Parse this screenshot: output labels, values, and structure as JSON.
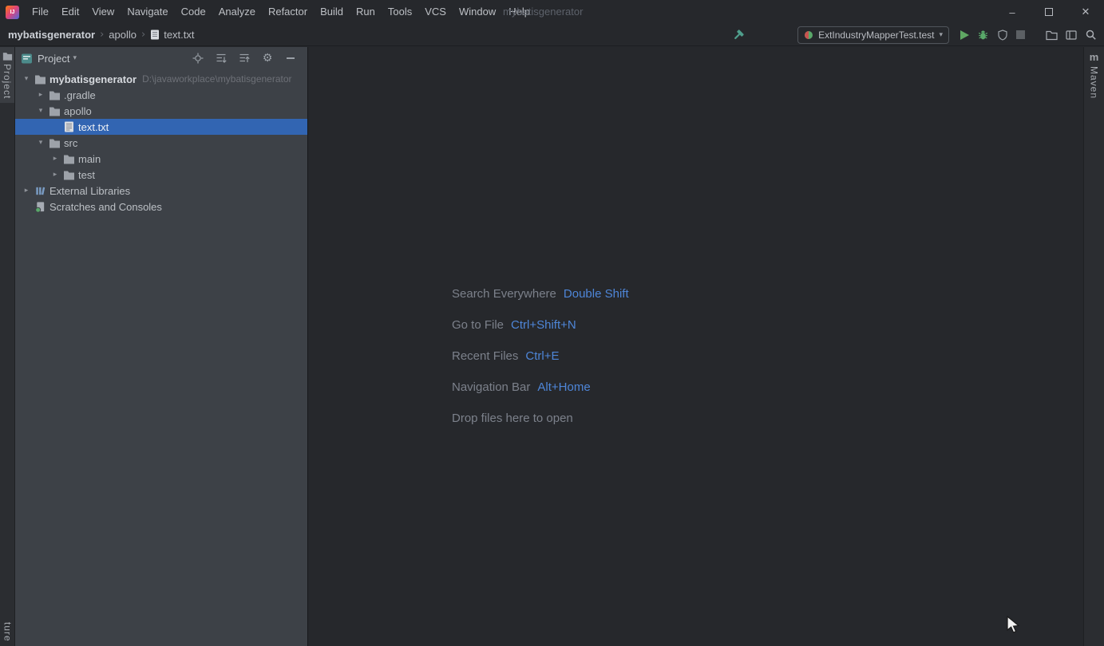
{
  "icons": {
    "logo_text": "IJ",
    "minimize": "–",
    "close": "✕",
    "dropdown": "▾",
    "chevron_down": "▾",
    "chevron_right": "▸",
    "breadcrumb_sep": "›",
    "gear": "⚙",
    "maven_logo": "m"
  },
  "titlebar": {
    "menus": [
      "File",
      "Edit",
      "View",
      "Navigate",
      "Code",
      "Analyze",
      "Refactor",
      "Build",
      "Run",
      "Tools",
      "VCS",
      "Window",
      "Help"
    ],
    "window_title": "mybatisgenerator"
  },
  "navbar": {
    "breadcrumb": [
      "mybatisgenerator",
      "apollo",
      "text.txt"
    ],
    "run_config": "ExtIndustryMapperTest.test"
  },
  "project_panel": {
    "title": "Project",
    "tree": [
      {
        "label": "mybatisgenerator",
        "path": "D:\\javaworkplace\\mybatisgenerator"
      },
      {
        "label": ".gradle"
      },
      {
        "label": "apollo"
      },
      {
        "label": "text.txt"
      },
      {
        "label": "src"
      },
      {
        "label": "main"
      },
      {
        "label": "test"
      },
      {
        "label": "External Libraries"
      },
      {
        "label": "Scratches and Consoles"
      }
    ]
  },
  "editor": {
    "shortcuts": [
      {
        "label": "Search Everywhere",
        "keys": "Double Shift"
      },
      {
        "label": "Go to File",
        "keys": "Ctrl+Shift+N"
      },
      {
        "label": "Recent Files",
        "keys": "Ctrl+E"
      },
      {
        "label": "Navigation Bar",
        "keys": "Alt+Home"
      }
    ],
    "drop_hint": "Drop files here to open"
  },
  "stripes": {
    "project_tab": "Project",
    "structure_tab": "ture",
    "maven_tab": "Maven"
  },
  "colors": {
    "selection_blue": "#3265b2",
    "shortcut_key_blue": "#4e86d8",
    "run_green": "#59a869",
    "panel_bg": "#3d4147",
    "bar_bg": "#26282c"
  }
}
